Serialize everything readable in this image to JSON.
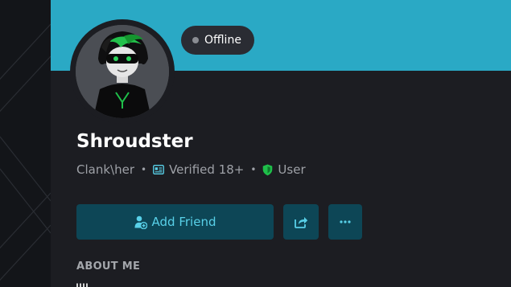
{
  "profile": {
    "status": "Offline",
    "username": "Shroudster",
    "pronouns": "Clank\\her",
    "verified_label": "Verified 18+",
    "role_label": "User",
    "separator": "•"
  },
  "actions": {
    "add_friend_label": "Add Friend",
    "share_icon": "share-icon",
    "more_icon": "more-icon"
  },
  "sections": {
    "about_heading": "ABOUT ME"
  },
  "colors": {
    "banner": "#2aa9c5",
    "card": "#1c1d22",
    "button": "#0d4656",
    "accent": "#58d0e8",
    "shield": "#1fbf4a"
  }
}
